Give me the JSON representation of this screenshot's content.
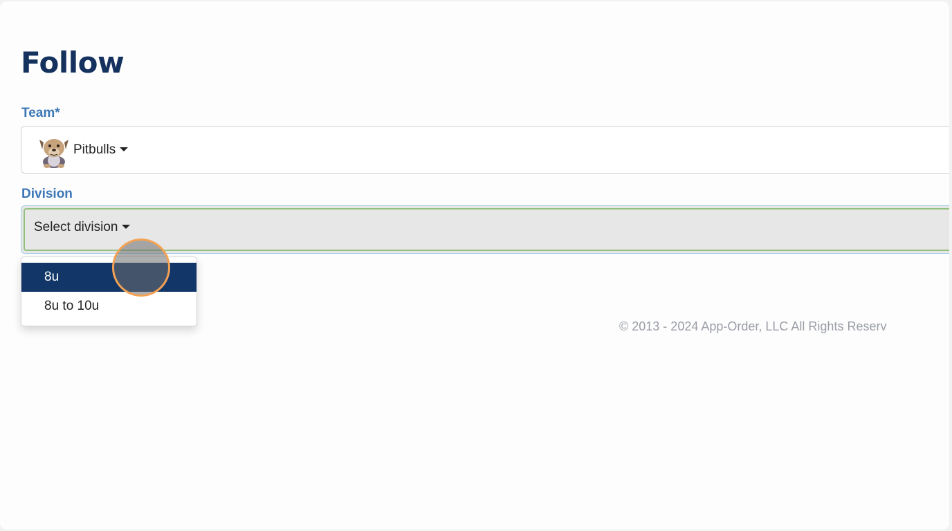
{
  "page": {
    "title": "Follow"
  },
  "team_field": {
    "label": "Team*",
    "selected_team": "Pitbulls",
    "logo_icon": "pitbull-logo-icon"
  },
  "division_field": {
    "label": "Division",
    "placeholder": "Select division",
    "options": [
      {
        "label": "8u",
        "highlighted": true
      },
      {
        "label": "8u to 10u",
        "highlighted": false
      }
    ]
  },
  "footer": {
    "copyright": "© 2013 - 2024 App-Order, LLC All Rights Reserv"
  },
  "colors": {
    "title": "#15315e",
    "label": "#3b76b6",
    "highlight": "#123668",
    "focus_border": "#93c07c",
    "cursor_ring": "#f3a254"
  }
}
